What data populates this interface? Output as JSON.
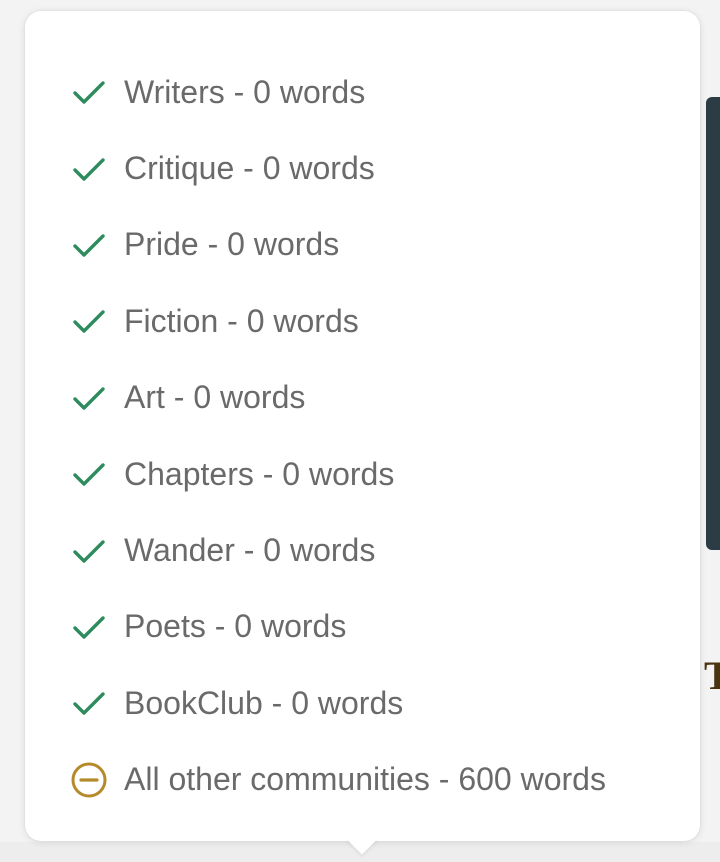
{
  "colors": {
    "check": "#2e8b5e",
    "partial": "#b58a2a",
    "text": "#6a6a6a"
  },
  "communities": [
    {
      "label": "Writers - 0 words",
      "icon": "check-icon"
    },
    {
      "label": "Critique - 0 words",
      "icon": "check-icon"
    },
    {
      "label": "Pride - 0 words",
      "icon": "check-icon"
    },
    {
      "label": "Fiction - 0 words",
      "icon": "check-icon"
    },
    {
      "label": "Art - 0 words",
      "icon": "check-icon"
    },
    {
      "label": "Chapters - 0 words",
      "icon": "check-icon"
    },
    {
      "label": "Wander - 0 words",
      "icon": "check-icon"
    },
    {
      "label": "Poets - 0 words",
      "icon": "check-icon"
    },
    {
      "label": "BookClub - 0 words",
      "icon": "check-icon"
    },
    {
      "label": "All other communities - 600 words",
      "icon": "minus-circle-icon"
    }
  ],
  "background": {
    "letter": "T",
    "bottom_text": "| ̲̲ |"
  }
}
